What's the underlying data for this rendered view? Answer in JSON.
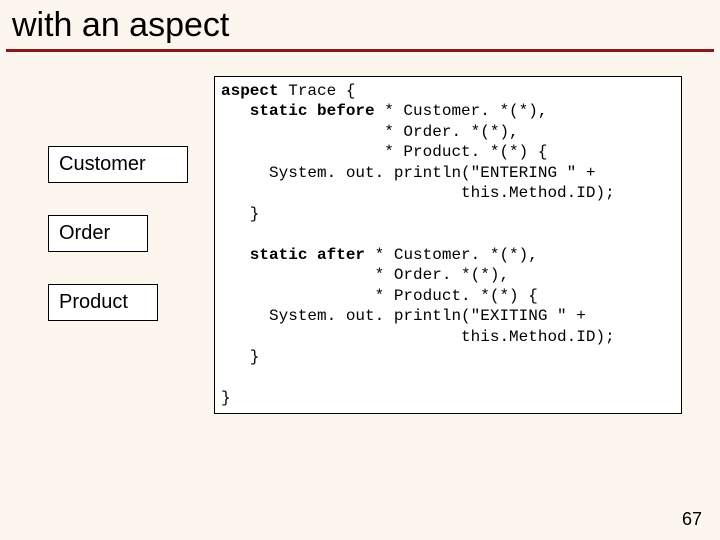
{
  "title": "with an aspect",
  "entities": {
    "customer": "Customer",
    "order": "Order",
    "product": "Product"
  },
  "code": {
    "l01a": "aspect",
    "l01b": " Trace {",
    "l02a": "   static before",
    "l02b": " * Customer. *(*),",
    "l03": "                 * Order. *(*),",
    "l04": "                 * Product. *(*) {",
    "l05": "     System. out. println(\"ENTERING \" +",
    "l06": "                         this.Method.ID);",
    "l07": "   }",
    "l08": "",
    "l09a": "   static after",
    "l09b": " * Customer. *(*),",
    "l10": "                * Order. *(*),",
    "l11": "                * Product. *(*) {",
    "l12": "     System. out. println(\"EXITING \" +",
    "l13": "                         this.Method.ID);",
    "l14": "   }",
    "l15": "",
    "l16": "}"
  },
  "page_number": "67"
}
